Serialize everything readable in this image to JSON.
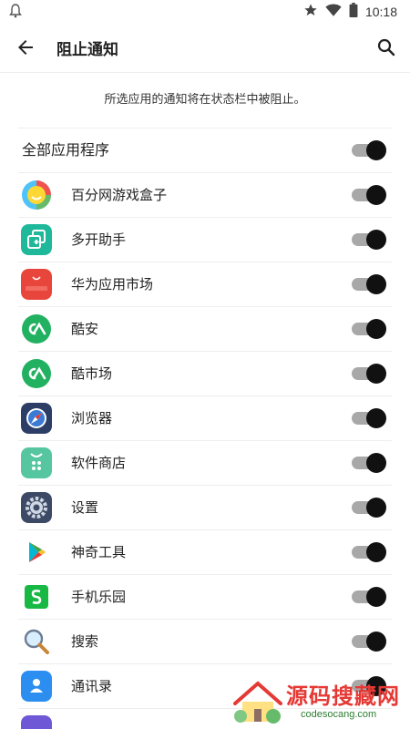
{
  "status": {
    "time": "10:18"
  },
  "header": {
    "title": "阻止通知"
  },
  "description": "所选应用的通知将在状态栏中被阻止。",
  "all_apps": {
    "label": "全部应用程序",
    "on": true
  },
  "apps": [
    {
      "label": "百分网游戏盒子",
      "icon": "game-box-icon",
      "on": true
    },
    {
      "label": "多开助手",
      "icon": "multi-open-icon",
      "on": true
    },
    {
      "label": "华为应用市场",
      "icon": "huawei-appgallery-icon",
      "on": true
    },
    {
      "label": "酷安",
      "icon": "coolapk-icon",
      "on": true
    },
    {
      "label": "酷市场",
      "icon": "coolmarket-icon",
      "on": true
    },
    {
      "label": "浏览器",
      "icon": "browser-compass-icon",
      "on": true
    },
    {
      "label": "软件商店",
      "icon": "software-store-icon",
      "on": true
    },
    {
      "label": "设置",
      "icon": "settings-gear-icon",
      "on": true
    },
    {
      "label": "神奇工具",
      "icon": "play-triangle-icon",
      "on": true
    },
    {
      "label": "手机乐园",
      "icon": "phone-park-icon",
      "on": true
    },
    {
      "label": "搜索",
      "icon": "magnifier-icon",
      "on": true
    },
    {
      "label": "通讯录",
      "icon": "contacts-icon",
      "on": true
    }
  ],
  "watermark": {
    "text": "源码搜藏网",
    "sub": "codesocang.com"
  },
  "colors": {
    "thumb": "#111111",
    "track": "#a8a8a8",
    "divider": "#eeeeee"
  }
}
